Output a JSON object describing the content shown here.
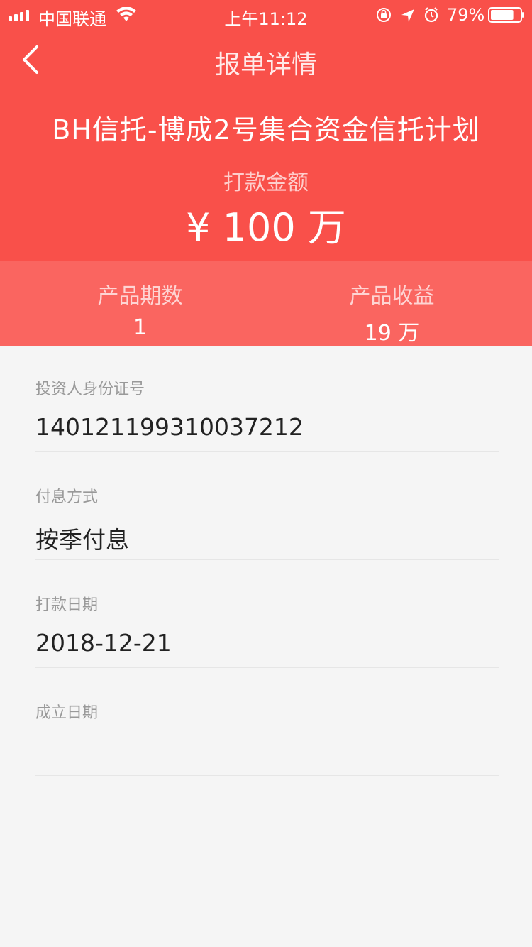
{
  "status_bar": {
    "carrier": "中国联通",
    "time": "上午11:12",
    "battery_percent": "79%",
    "battery_level": 0.79,
    "icons": [
      "signal-icon",
      "wifi-icon",
      "orientation-lock-icon",
      "location-icon",
      "alarm-icon",
      "battery-icon"
    ]
  },
  "nav": {
    "title": "报单详情",
    "back_icon": "chevron-left-icon"
  },
  "header": {
    "product_name": "BH信托-博成2号集合资金信托计划",
    "amount_label": "打款金额",
    "amount_value": "¥ 100 万"
  },
  "stats": {
    "period_label": "产品期数",
    "period_value": "1",
    "income_label": "产品收益",
    "income_value": "19 万"
  },
  "details": [
    {
      "label": "投资人身份证号",
      "value": "140121199310037212"
    },
    {
      "label": "付息方式",
      "value": "按季付息"
    },
    {
      "label": "打款日期",
      "value": "2018-12-21"
    },
    {
      "label": "成立日期",
      "value": ""
    }
  ],
  "colors": {
    "header_bg": "#f9504a",
    "stats_bg": "#fa6560",
    "page_bg": "#f5f5f5",
    "label_text": "#999999",
    "value_text": "#222222"
  }
}
